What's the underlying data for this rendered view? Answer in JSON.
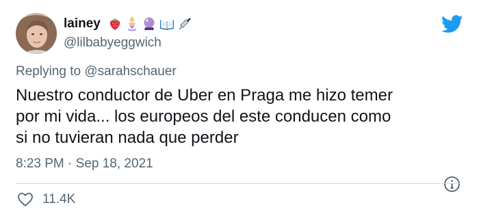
{
  "user": {
    "display_name": "lainey",
    "handle": "@lilbabyeggwich",
    "name_emojis": [
      "strawberry-icon",
      "genie-icon",
      "crystal-ball-icon",
      "open-book-icon",
      "syringe-icon"
    ]
  },
  "reply": {
    "prefix": "Replying to ",
    "mention": "@sarahschauer"
  },
  "tweet": {
    "text": "Nuestro conductor de Uber en Praga me hizo temer\npor mi vida... los europeos del este conducen como\nsi no tuvieran nada que perder",
    "time": "8:23 PM",
    "separator": "·",
    "date": "Sep 18, 2021"
  },
  "stats": {
    "likes": "11.4K"
  },
  "colors": {
    "twitter_blue": "#1d9bf0",
    "text_primary": "#0f1419",
    "text_secondary": "#536471",
    "divider": "#cfd9de"
  }
}
